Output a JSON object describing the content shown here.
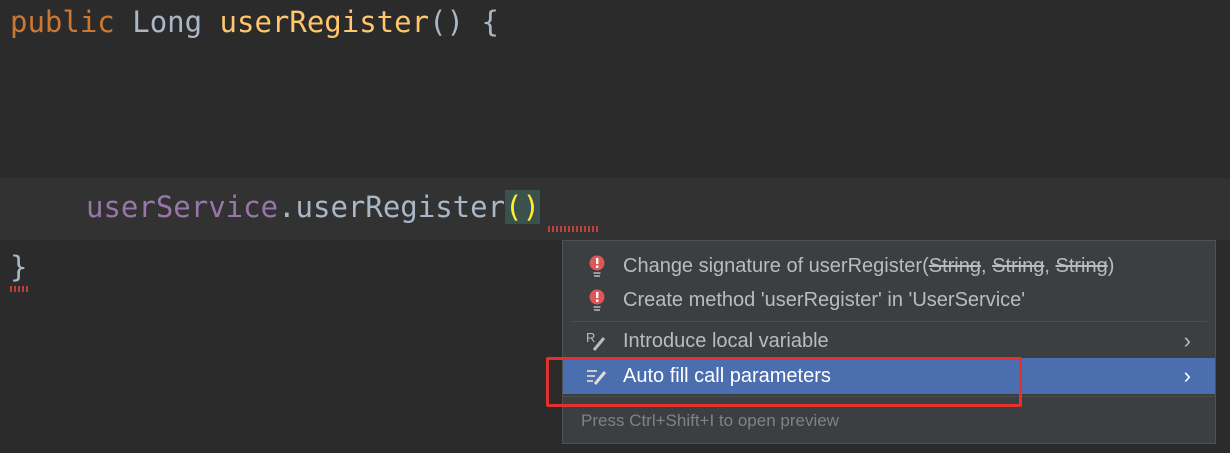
{
  "code": {
    "line1": {
      "kw": "public",
      "type": "Long",
      "name": "userRegister",
      "rest": "() {"
    },
    "line2": {
      "field": "userService",
      "dot": ".",
      "method": "userRegister",
      "parens": "()"
    },
    "line3": "}"
  },
  "popup": {
    "items": [
      {
        "icon": "bulb-error-icon",
        "prefix": "Change signature of userRegister(",
        "struck": [
          "String",
          "String",
          "String"
        ],
        "sep": ", ",
        "suffix": ")"
      },
      {
        "icon": "bulb-error-icon",
        "label": "Create method 'userRegister' in 'UserService'"
      },
      {
        "icon": "introduce-variable-icon",
        "label": "Introduce local variable",
        "chevron": "›"
      },
      {
        "icon": "auto-fill-icon",
        "label": "Auto fill call parameters",
        "chevron": "›",
        "selected": true
      }
    ],
    "footer": "Press Ctrl+Shift+I to open preview"
  },
  "colors": {
    "selection": "#4b6eaf",
    "highlight_box": "#e3322e"
  }
}
